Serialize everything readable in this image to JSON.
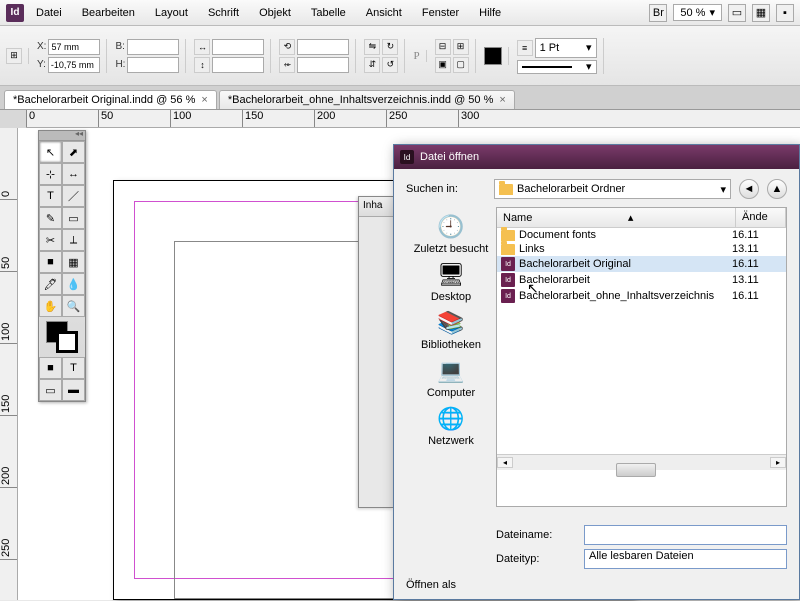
{
  "menu": {
    "items": [
      "Datei",
      "Bearbeiten",
      "Layout",
      "Schrift",
      "Objekt",
      "Tabelle",
      "Ansicht",
      "Fenster",
      "Hilfe"
    ],
    "zoom": "50 %"
  },
  "ctrl": {
    "x_label": "X:",
    "x": "57 mm",
    "y_label": "Y:",
    "y": "-10,75 mm",
    "b_label": "B:",
    "b": "",
    "h_label": "H:",
    "h": "",
    "stroke": "1 Pt"
  },
  "tabs": [
    {
      "label": "*Bachelorarbeit Original.indd @ 56 %",
      "active": true
    },
    {
      "label": "*Bachelorarbeit_ohne_Inhaltsverzeichnis.indd @ 50 %",
      "active": false
    }
  ],
  "ruler_h": [
    "0",
    "50",
    "100",
    "150",
    "200",
    "250",
    "300"
  ],
  "ruler_v": [
    "0",
    "50",
    "100",
    "150",
    "200",
    "250"
  ],
  "tools": [
    "↖",
    "⬈",
    "⊹",
    "↔",
    "T",
    "／",
    "✎",
    "▭",
    "✂",
    "⟂",
    "■",
    "▦",
    "🖊",
    "💧",
    "✋",
    "🔍"
  ],
  "partial_title": "Inha",
  "dialog": {
    "title": "Datei öffnen",
    "search_label": "Suchen in:",
    "folder": "Bachelorarbeit Ordner",
    "places": [
      "Zuletzt besucht",
      "Desktop",
      "Bibliotheken",
      "Computer",
      "Netzwerk"
    ],
    "cols": {
      "name": "Name",
      "date": "Ände"
    },
    "files": [
      {
        "icon": "folder",
        "name": "Document fonts",
        "date": "16.11"
      },
      {
        "icon": "folder",
        "name": "Links",
        "date": "13.11"
      },
      {
        "icon": "indd",
        "name": "Bachelorarbeit Original",
        "date": "16.11",
        "sel": true
      },
      {
        "icon": "indd",
        "name": "Bachelorarbeit",
        "date": "13.11"
      },
      {
        "icon": "indd",
        "name": "Bachelorarbeit_ohne_Inhaltsverzeichnis",
        "date": "16.11"
      }
    ],
    "filename_label": "Dateiname:",
    "filename": "",
    "filetype_label": "Dateityp:",
    "filetype": "Alle lesbaren Dateien",
    "open_as": "Öffnen als"
  }
}
